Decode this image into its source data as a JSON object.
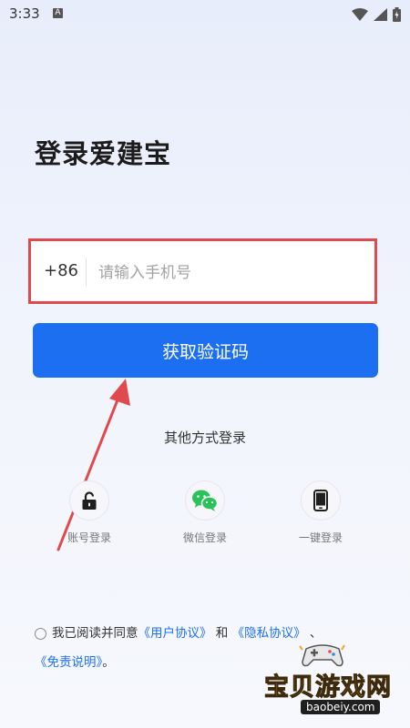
{
  "status_bar": {
    "time": "3:33",
    "notification_letter": "A"
  },
  "login": {
    "title": "登录爱建宝",
    "country_code": "+86",
    "phone_placeholder": "请输入手机号",
    "get_code_button": "获取验证码"
  },
  "other_methods": {
    "title": "其他方式登录",
    "items": [
      {
        "label": "账号登录",
        "icon": "lock-icon"
      },
      {
        "label": "微信登录",
        "icon": "wechat-icon"
      },
      {
        "label": "一键登录",
        "icon": "phone-icon"
      }
    ]
  },
  "agreement": {
    "prefix": "我已阅读并同意",
    "user_agreement": "《用户协议》",
    "and": "和",
    "privacy_agreement": "《隐私协议》",
    "separator": "、",
    "disclaimer": "《免责说明》",
    "period": "。"
  },
  "watermark": {
    "name": "宝贝游戏网",
    "url": "baobeiy.com"
  },
  "colors": {
    "primary": "#1d6ff2",
    "annotation_red": "#e04a4f",
    "wechat_green": "#2bc25a"
  }
}
